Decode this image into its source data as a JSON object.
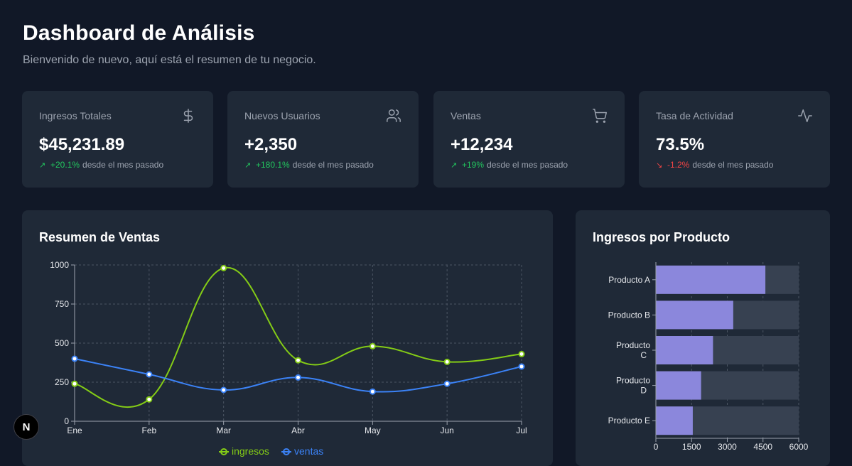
{
  "header": {
    "title": "Dashboard de Análisis",
    "subtitle": "Bienvenido de nuevo, aquí está el resumen de tu negocio."
  },
  "stats": [
    {
      "label": "Ingresos Totales",
      "value": "$45,231.89",
      "change": "+20.1%",
      "suffix": "desde el mes pasado",
      "trend": "up",
      "icon": "dollar-icon"
    },
    {
      "label": "Nuevos Usuarios",
      "value": "+2,350",
      "change": "+180.1%",
      "suffix": "desde el mes pasado",
      "trend": "up",
      "icon": "users-icon"
    },
    {
      "label": "Ventas",
      "value": "+12,234",
      "change": "+19%",
      "suffix": "desde el mes pasado",
      "trend": "up",
      "icon": "cart-icon"
    },
    {
      "label": "Tasa de Actividad",
      "value": "73.5%",
      "change": "-1.2%",
      "suffix": "desde el mes pasado",
      "trend": "down",
      "icon": "activity-icon"
    }
  ],
  "sales_panel": {
    "title": "Resumen de Ventas"
  },
  "product_panel": {
    "title": "Ingresos por Producto"
  },
  "fab": {
    "label": "N"
  },
  "colors": {
    "ingresos": "#84cc16",
    "ventas": "#3b82f6",
    "bar": "#8b87dc",
    "up": "#22c55e",
    "down": "#ef4444"
  },
  "chart_data": [
    {
      "type": "line",
      "categories": [
        "Ene",
        "Feb",
        "Mar",
        "Abr",
        "May",
        "Jun",
        "Jul"
      ],
      "series": [
        {
          "name": "ingresos",
          "values": [
            240,
            140,
            980,
            390,
            480,
            380,
            430
          ]
        },
        {
          "name": "ventas",
          "values": [
            400,
            300,
            200,
            280,
            190,
            240,
            350
          ]
        }
      ],
      "ylim": [
        0,
        1000
      ],
      "yticks": [
        0,
        250,
        500,
        750,
        1000
      ],
      "grid": true,
      "legend": "bottom"
    },
    {
      "type": "bar",
      "orientation": "horizontal",
      "categories": [
        "Producto A",
        "Producto B",
        "Producto C",
        "Producto D",
        "Producto E"
      ],
      "values": [
        4600,
        3250,
        2400,
        1900,
        1550
      ],
      "xlim": [
        0,
        6000
      ],
      "xticks": [
        0,
        1500,
        3000,
        4500,
        6000
      ],
      "grid": true
    }
  ]
}
